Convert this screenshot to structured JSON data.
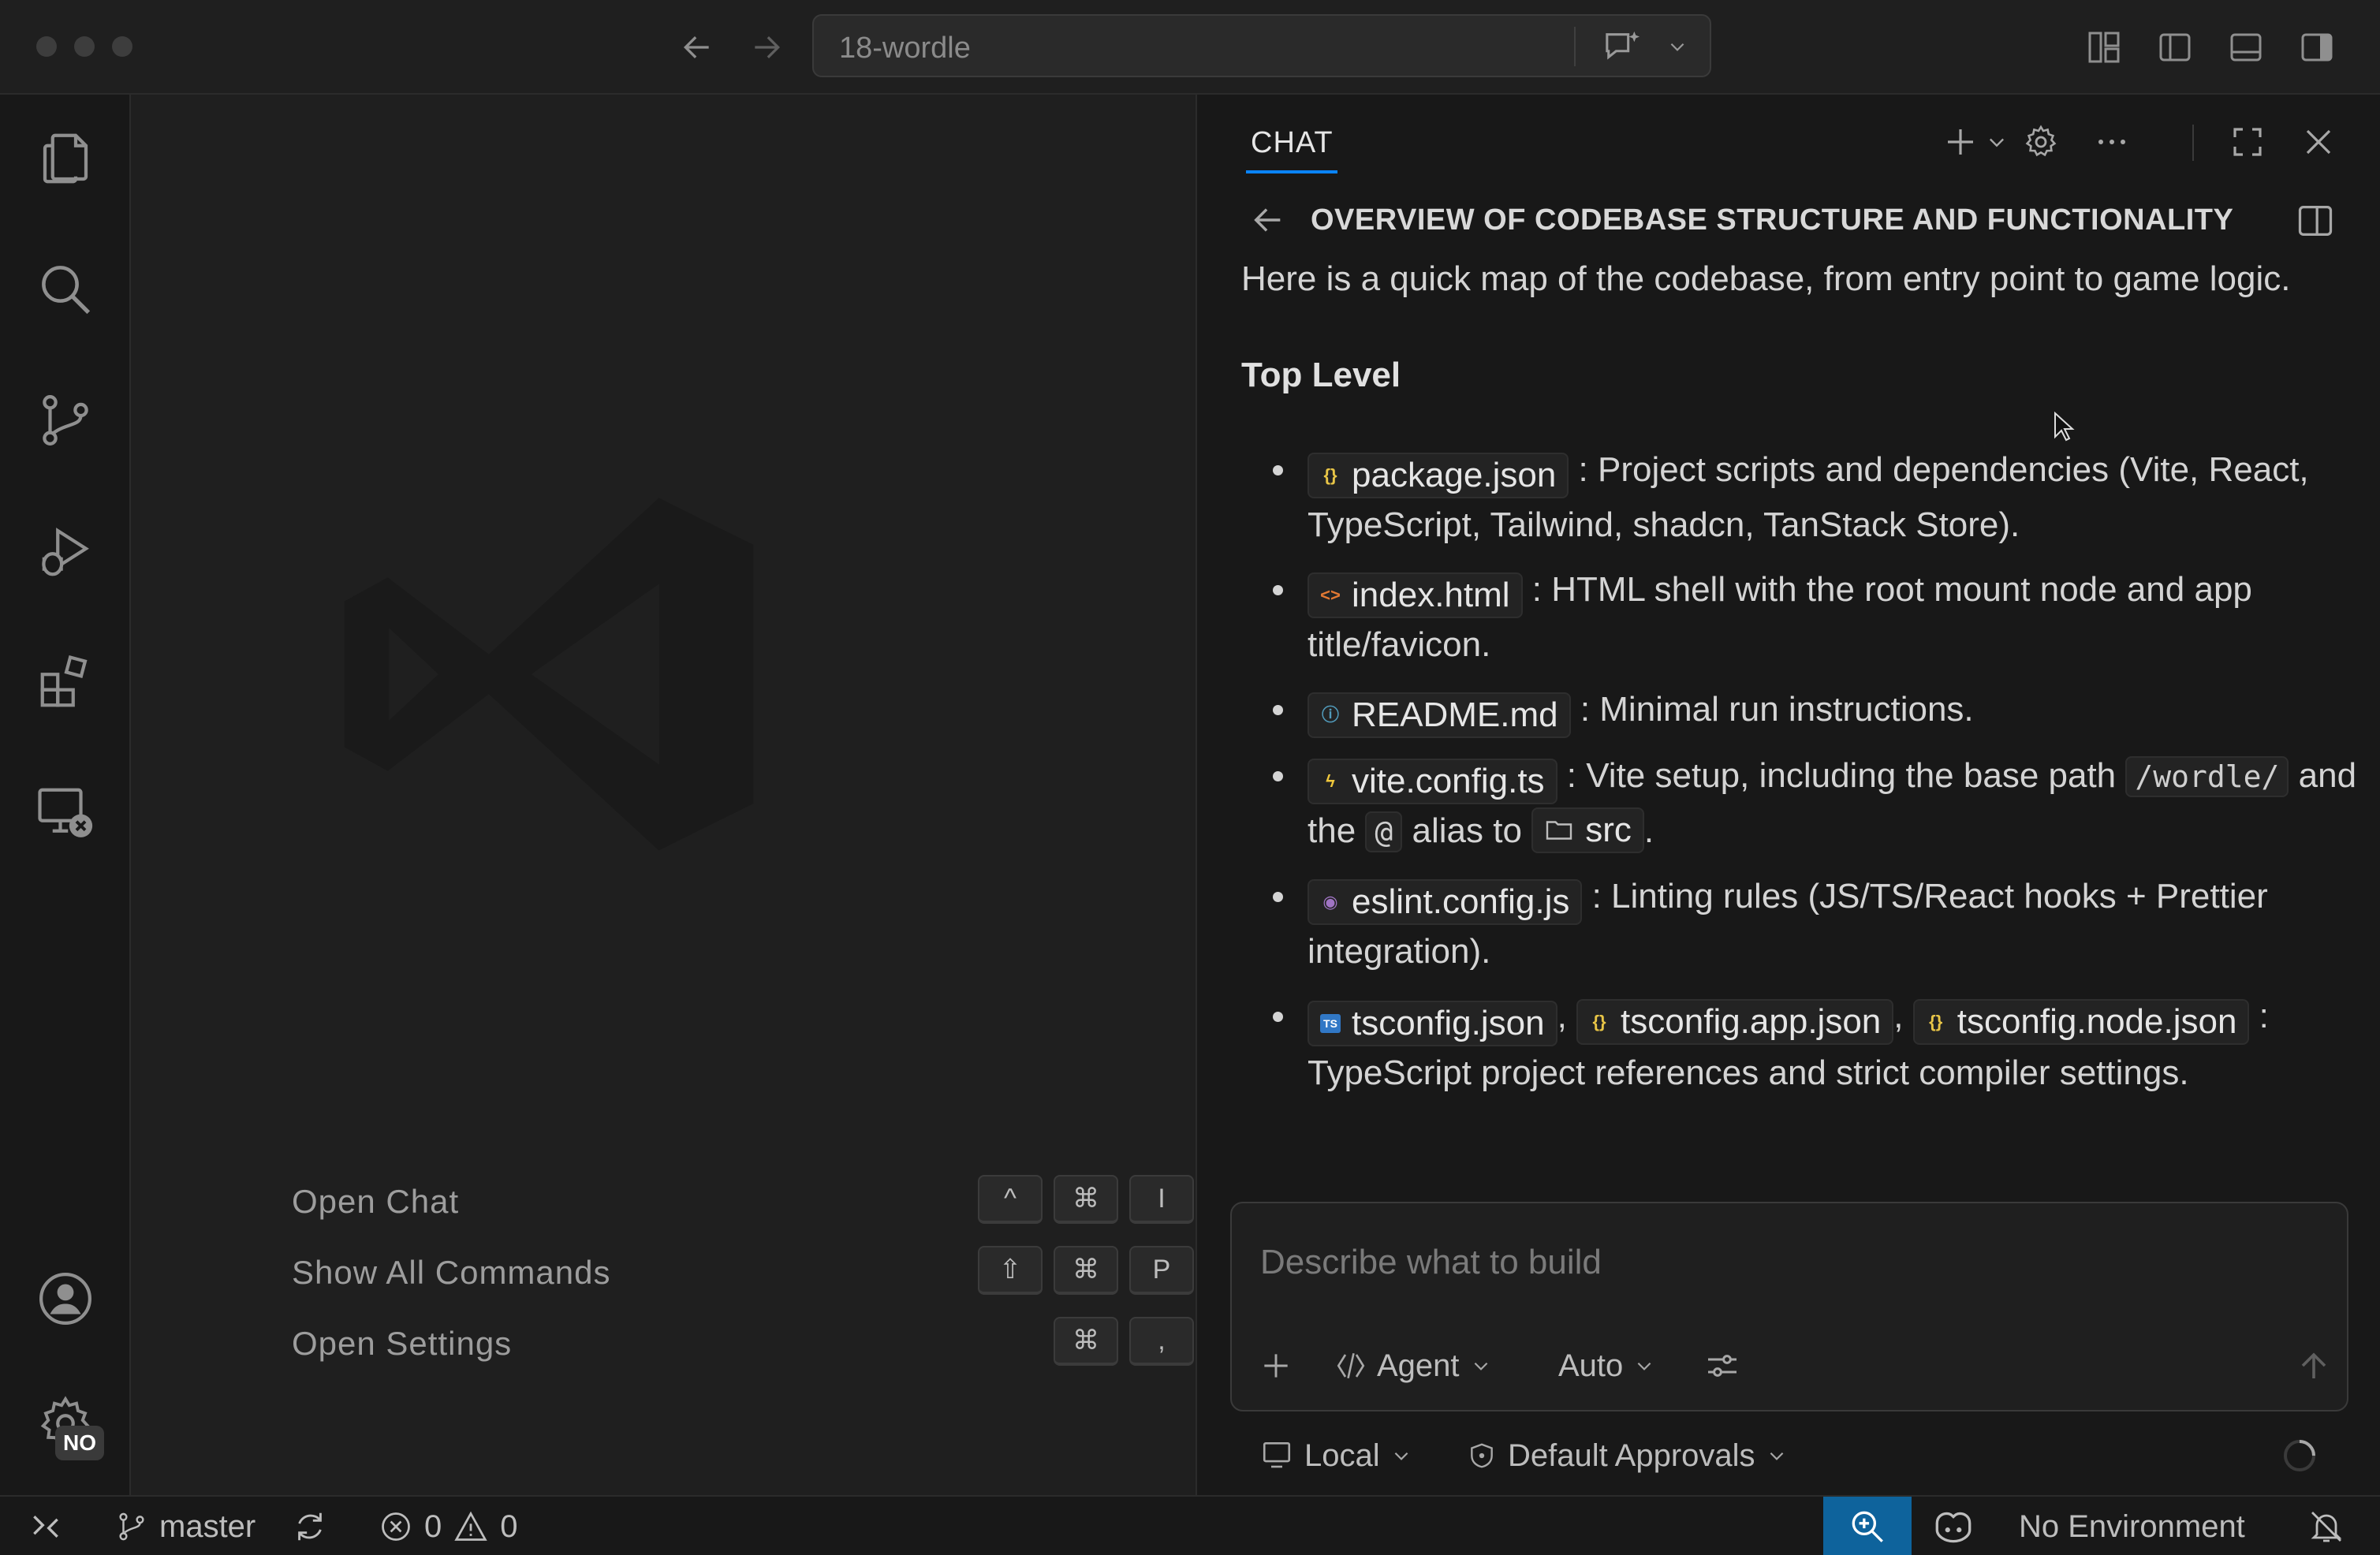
{
  "window": {
    "command_center": "18-wordle"
  },
  "editor": {
    "hints": [
      {
        "label": "Open Chat",
        "keys": [
          "^",
          "⌘",
          "I"
        ]
      },
      {
        "label": "Show All Commands",
        "keys": [
          "⇧",
          "⌘",
          "P"
        ]
      },
      {
        "label": "Open Settings",
        "keys": [
          "⌘",
          ","
        ]
      }
    ]
  },
  "activitybar": {
    "settings_badge": "NO"
  },
  "chat": {
    "tab_label": "CHAT",
    "thread_title": "OVERVIEW OF CODEBASE STRUCTURE AND FUNCTIONALITY",
    "intro": "Here is a quick map of the codebase, from entry point to game logic.",
    "section_heading": "Top Level",
    "items": [
      {
        "file": "package.json",
        "text": ": Project scripts and dependencies (Vite, React, TypeScript, Tailwind, shadcn, TanStack Store)."
      },
      {
        "file": "index.html",
        "text": ": HTML shell with the root mount node and app title/favicon."
      },
      {
        "file": "README.md",
        "text": ": Minimal run instructions."
      },
      {
        "file": "vite.config.ts",
        "text_a": ": Vite setup, including the base path",
        "code_path": "/wordle/",
        "text_b": "and the",
        "code_alias": "@",
        "text_c": "alias to",
        "folder": "src",
        "text_d": "."
      },
      {
        "file": "eslint.config.js",
        "text": ": Linting rules (JS/TS/React hooks + Prettier integration)."
      },
      {
        "files": [
          "tsconfig.json",
          "tsconfig.app.json",
          "tsconfig.node.json"
        ],
        "sep": ",",
        "text": ": TypeScript project references and strict compiler settings."
      }
    ],
    "input_placeholder": "Describe what to build",
    "mode_label": "Agent",
    "model_label": "Auto",
    "location_label": "Local",
    "approvals_label": "Default Approvals"
  },
  "statusbar": {
    "branch": "master",
    "errors": "0",
    "warnings": "0",
    "environment": "No Environment"
  },
  "colors": {
    "accent": "#0a84ff",
    "status_highlight": "#0e639c"
  }
}
